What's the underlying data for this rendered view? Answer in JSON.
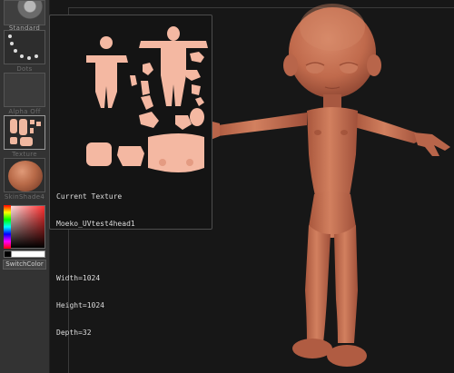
{
  "palette": {
    "tiles": [
      {
        "label": "Standard"
      },
      {
        "label": "Dots"
      },
      {
        "label": "Alpha Off"
      },
      {
        "label": "Texture"
      },
      {
        "label": "SkinShade4"
      }
    ],
    "switch_color": "SwitchColor"
  },
  "tooltip": {
    "heading": "Current Texture",
    "name": "Moeko_UVtest4head1",
    "width": "Width=1024",
    "height": "Height=1024",
    "depth": "Depth=32"
  },
  "colors": {
    "skin": "#c47457",
    "uv_skin": "#f4b8a2",
    "background": "#181818"
  }
}
